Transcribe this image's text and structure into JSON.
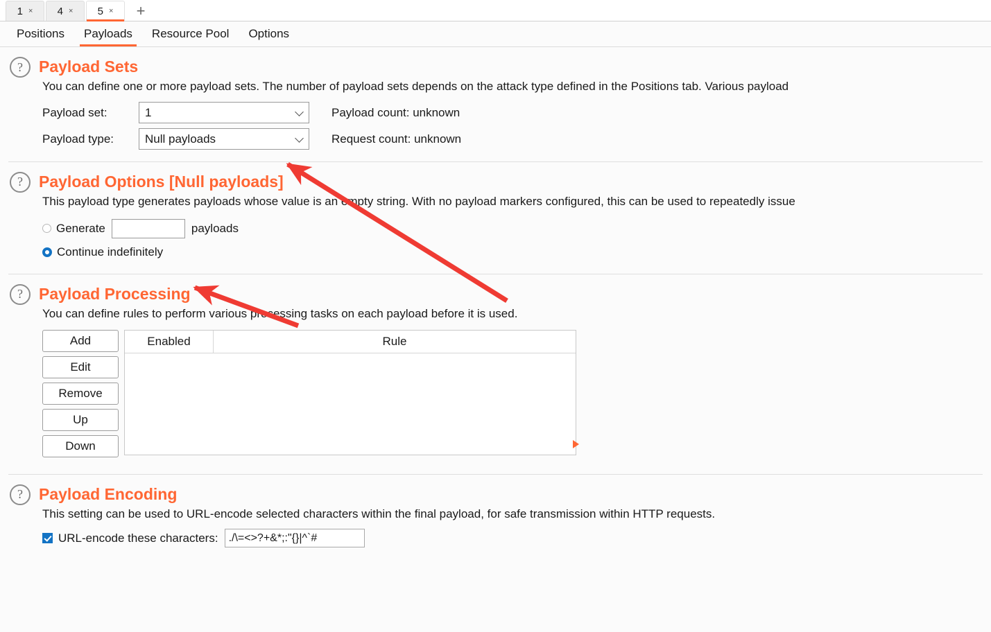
{
  "window_tabs": [
    {
      "label": "1",
      "close": "×",
      "active": false
    },
    {
      "label": "4",
      "close": "×",
      "active": false
    },
    {
      "label": "5",
      "close": "×",
      "active": true
    }
  ],
  "new_tab_icon": "+",
  "sub_tabs": [
    {
      "label": "Positions",
      "active": false
    },
    {
      "label": "Payloads",
      "active": true
    },
    {
      "label": "Resource Pool",
      "active": false
    },
    {
      "label": "Options",
      "active": false
    }
  ],
  "payload_sets": {
    "help_icon": "?",
    "title": "Payload Sets",
    "description": "You can define one or more payload sets. The number of payload sets depends on the attack type defined in the Positions tab. Various payload",
    "payload_set_label": "Payload set:",
    "payload_set_value": "1",
    "payload_type_label": "Payload type:",
    "payload_type_value": "Null payloads",
    "payload_count": "Payload count: unknown",
    "request_count": "Request count: unknown"
  },
  "payload_options": {
    "help_icon": "?",
    "title": "Payload Options [Null payloads]",
    "description": "This payload type generates payloads whose value is an empty string. With no payload markers configured, this can be used to repeatedly issue",
    "generate_label": "Generate",
    "generate_value": "",
    "generate_suffix": "payloads",
    "generate_selected": false,
    "continue_label": "Continue indefinitely",
    "continue_selected": true
  },
  "payload_processing": {
    "help_icon": "?",
    "title": "Payload Processing",
    "description": "You can define rules to perform various processing tasks on each payload before it is used.",
    "buttons": [
      "Add",
      "Edit",
      "Remove",
      "Up",
      "Down"
    ],
    "columns": [
      "Enabled",
      "Rule"
    ],
    "rows": []
  },
  "payload_encoding": {
    "help_icon": "?",
    "title": "Payload Encoding",
    "description": "This setting can be used to URL-encode selected characters within the final payload, for safe transmission within HTTP requests.",
    "checkbox_label": "URL-encode these characters:",
    "checkbox_checked": true,
    "characters_value": "./\\=<>?+&*;:\"{}|^`#"
  },
  "colors": {
    "accent": "#ff6633",
    "selection_blue": "#1373c4",
    "annotation_red": "#ef3b33",
    "background": "#fbfbfb"
  },
  "annotations": [
    {
      "name": "arrow-to-payload-type",
      "target": "payload-type-combo"
    },
    {
      "name": "arrow-to-continue-indefinitely",
      "target": "continue-indefinitely-radio"
    }
  ]
}
